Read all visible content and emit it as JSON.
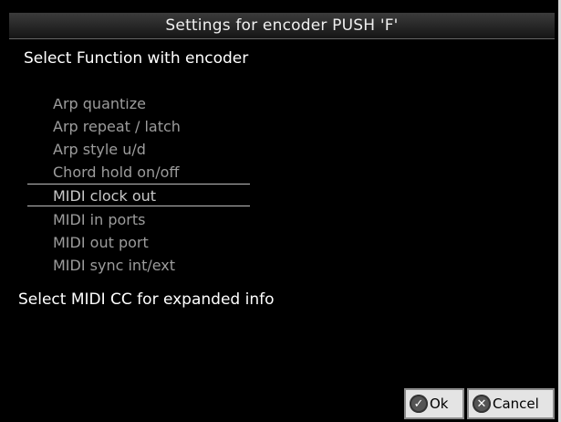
{
  "dialog": {
    "title": "Settings for encoder PUSH 'F'",
    "prompt": "Select Function with encoder",
    "info": "Select MIDI CC for expanded info"
  },
  "functions": {
    "items": [
      {
        "label": "Arp quantize",
        "selected": false
      },
      {
        "label": "Arp repeat / latch",
        "selected": false
      },
      {
        "label": "Arp style u/d",
        "selected": false
      },
      {
        "label": "Chord hold on/off",
        "selected": false
      },
      {
        "label": "MIDI clock out",
        "selected": true
      },
      {
        "label": "MIDI in ports",
        "selected": false
      },
      {
        "label": "MIDI out port",
        "selected": false
      },
      {
        "label": "MIDI sync int/ext",
        "selected": false
      }
    ]
  },
  "buttons": {
    "ok_label": "Ok",
    "cancel_label": "Cancel",
    "ok_icon": "check-icon",
    "cancel_icon": "x-icon"
  }
}
